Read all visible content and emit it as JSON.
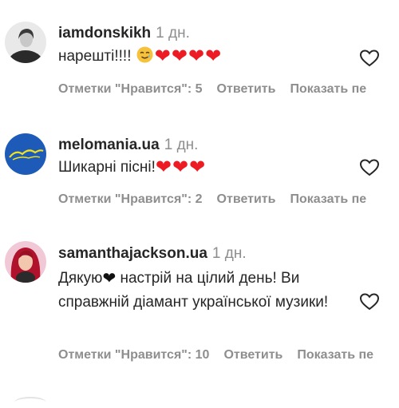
{
  "comments": [
    {
      "username": "iamdonskikh",
      "time": "1 дн.",
      "text_start": "нарешті!!!! ",
      "emoji_smile": "smiling-face-with-tear-icon",
      "hearts": "❤❤❤❤",
      "likes_label": "Отметки \"Нравится\": 5",
      "reply_label": "Ответить",
      "show_label": "Показать пе"
    },
    {
      "username": "melomania.ua",
      "time": "1 дн.",
      "text_start": "Шикарні пісні!",
      "hearts": "❤❤❤",
      "likes_label": "Отметки \"Нравится\": 2",
      "reply_label": "Ответить",
      "show_label": "Показать пе"
    },
    {
      "username": "samanthajackson.ua",
      "time": "1 дн.",
      "text_part1": "Дякую",
      "black_heart": "❤",
      "text_part2": " настрій на цілий день! Ви справжній діамант української музики!",
      "likes_label": "Отметки \"Нравится\": 10",
      "reply_label": "Ответить",
      "show_label": "Показать пе"
    }
  ],
  "colors": {
    "text": "#262626",
    "muted": "#8e8e8e",
    "heart": "#ed1c24",
    "melomania_bg": "#1e5bb8",
    "melomania_logo": "#f2e21a"
  }
}
